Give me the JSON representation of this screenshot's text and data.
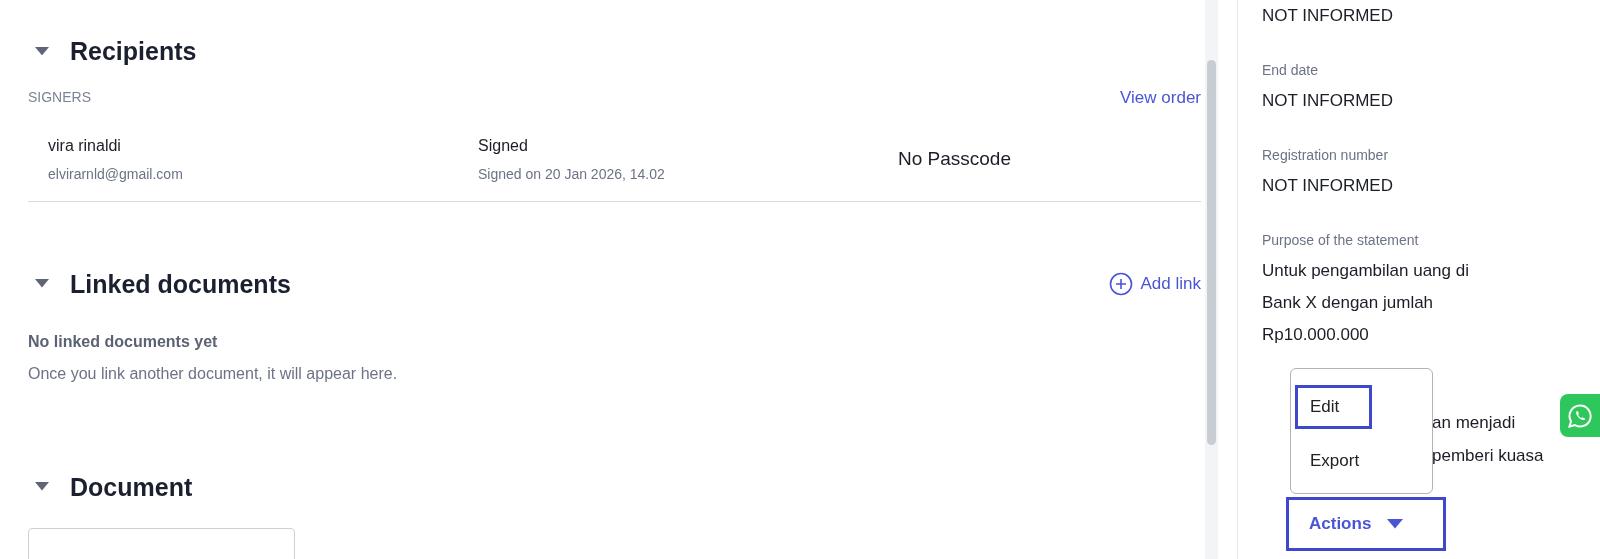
{
  "recipients": {
    "title": "Recipients",
    "expanded": true,
    "group_label": "SIGNERS",
    "view_order": "View order",
    "signers": [
      {
        "name": "vira rinaldi",
        "email": "elvirarnld@gmail.com",
        "status": "Signed",
        "signed_on": "Signed on 20 Jan 2026, 14.02",
        "passcode": "No Passcode"
      }
    ]
  },
  "linked_documents": {
    "title": "Linked documents",
    "expanded": true,
    "add_link": "Add link",
    "empty_title": "No linked documents yet",
    "empty_text": "Once you link another document, it will appear here."
  },
  "document": {
    "title": "Document",
    "expanded": true
  },
  "details": [
    {
      "value_lines": [
        "NOT INFORMED"
      ]
    },
    {
      "label": "End date",
      "value_lines": [
        "NOT INFORMED"
      ]
    },
    {
      "label": "Registration number",
      "value_lines": [
        "NOT INFORMED"
      ]
    },
    {
      "label": "Purpose of the statement",
      "value_lines": [
        "Untuk pengambilan uang di",
        "Bank X dengan jumlah",
        "Rp10.000.000"
      ]
    }
  ],
  "partial_lines": [
    "an menjadi",
    "pemberi kuasa"
  ],
  "actions_menu": {
    "items": [
      {
        "label": "Edit",
        "selected": true
      },
      {
        "label": "Export",
        "selected": false
      }
    ]
  },
  "actions_button": {
    "label": "Actions",
    "highlighted": true
  }
}
